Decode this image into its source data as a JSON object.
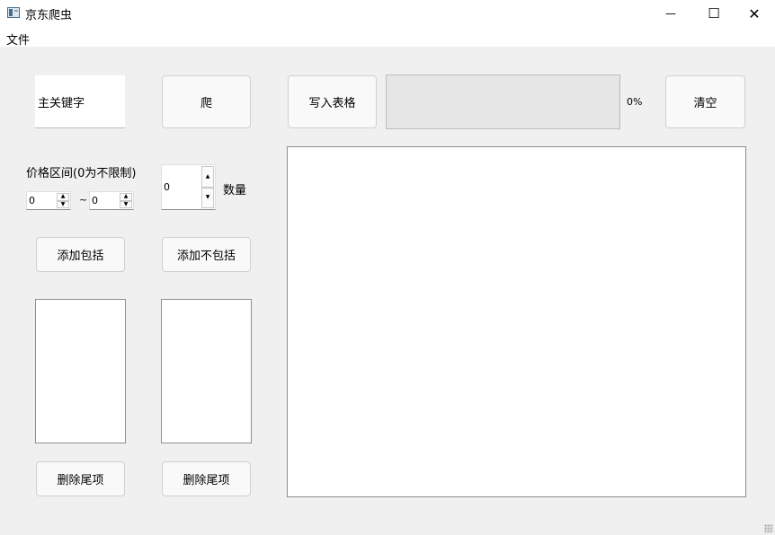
{
  "window": {
    "title": "京东爬虫",
    "minimize_glyph": "—",
    "maximize_glyph": "☐",
    "close_glyph": "✕"
  },
  "menubar": {
    "file": "文件"
  },
  "search": {
    "keyword_value": "主关键字",
    "crawl_button": "爬"
  },
  "toolbar": {
    "write_table_button": "写入表格",
    "clear_button": "清空"
  },
  "progress": {
    "value": 0,
    "label": "0%"
  },
  "price": {
    "label": "价格区间(0为不限制)",
    "min": "0",
    "max": "0",
    "separator": "~"
  },
  "quantity": {
    "value": "0",
    "label": "数量"
  },
  "filters": {
    "add_include_button": "添加包括",
    "add_exclude_button": "添加不包括",
    "include_items": [],
    "exclude_items": [],
    "delete_last_include_button": "删除尾项",
    "delete_last_exclude_button": "删除尾项"
  },
  "output": {
    "text": ""
  }
}
